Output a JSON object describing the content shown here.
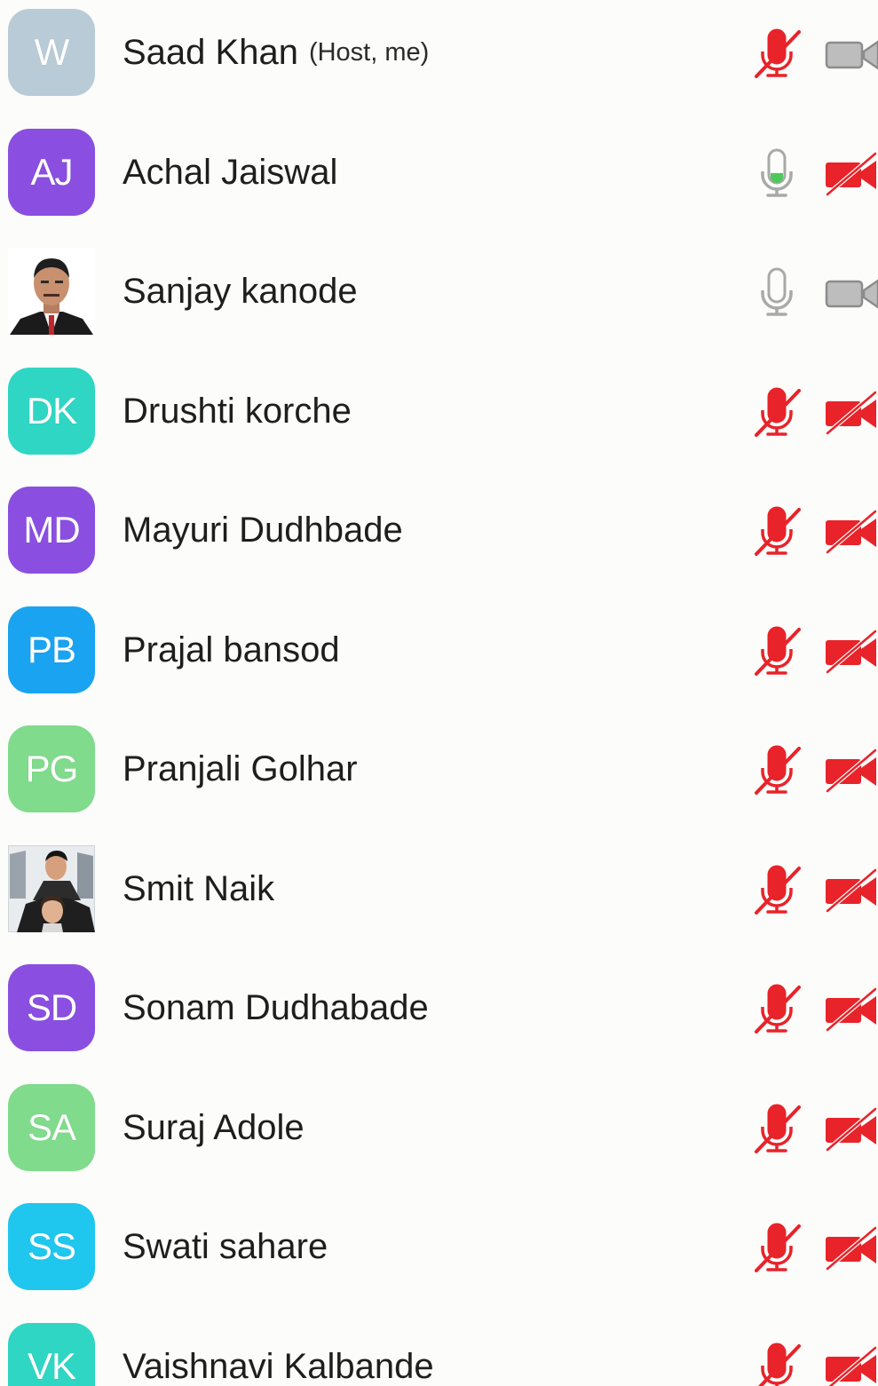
{
  "participants": [
    {
      "name": "Saad Khan",
      "role": "(Host, me)",
      "initials": "W",
      "avatar_type": "initials",
      "avatar_color": "#b9cbd6",
      "mic": "muted",
      "video": "off-gray"
    },
    {
      "name": "Achal Jaiswal",
      "role": "",
      "initials": "AJ",
      "avatar_type": "initials",
      "avatar_color": "#8a4fe0",
      "mic": "active",
      "video": "muted"
    },
    {
      "name": "Sanjay kanode",
      "role": "",
      "initials": "",
      "avatar_type": "photo",
      "avatar_color": "#ffffff",
      "mic": "on-gray",
      "video": "off-gray"
    },
    {
      "name": "Drushti korche",
      "role": "",
      "initials": "DK",
      "avatar_type": "initials",
      "avatar_color": "#2fd6c3",
      "mic": "muted",
      "video": "muted"
    },
    {
      "name": "Mayuri Dudhbade",
      "role": "",
      "initials": "MD",
      "avatar_type": "initials",
      "avatar_color": "#8a4fe0",
      "mic": "muted",
      "video": "muted"
    },
    {
      "name": "Prajal bansod",
      "role": "",
      "initials": "PB",
      "avatar_type": "initials",
      "avatar_color": "#1aa3f0",
      "mic": "muted",
      "video": "muted"
    },
    {
      "name": "Pranjali Golhar",
      "role": "",
      "initials": "PG",
      "avatar_type": "initials",
      "avatar_color": "#80db8c",
      "mic": "muted",
      "video": "muted"
    },
    {
      "name": "Smit Naik",
      "role": "",
      "initials": "",
      "avatar_type": "photo",
      "avatar_color": "#ffffff",
      "mic": "muted",
      "video": "muted"
    },
    {
      "name": "Sonam Dudhabade",
      "role": "",
      "initials": "SD",
      "avatar_type": "initials",
      "avatar_color": "#8a4fe0",
      "mic": "muted",
      "video": "muted"
    },
    {
      "name": "Suraj Adole",
      "role": "",
      "initials": "SA",
      "avatar_type": "initials",
      "avatar_color": "#80db8c",
      "mic": "muted",
      "video": "muted"
    },
    {
      "name": "Swati sahare",
      "role": "",
      "initials": "SS",
      "avatar_type": "initials",
      "avatar_color": "#1fc7ee",
      "mic": "muted",
      "video": "muted"
    },
    {
      "name": "Vaishnavi Kalbande",
      "role": "",
      "initials": "VK",
      "avatar_type": "initials",
      "avatar_color": "#2fd6c3",
      "mic": "muted",
      "video": "muted"
    }
  ],
  "colors": {
    "muted_red": "#e8232a",
    "active_green": "#4cc95a",
    "icon_gray": "#a9a9a9"
  }
}
